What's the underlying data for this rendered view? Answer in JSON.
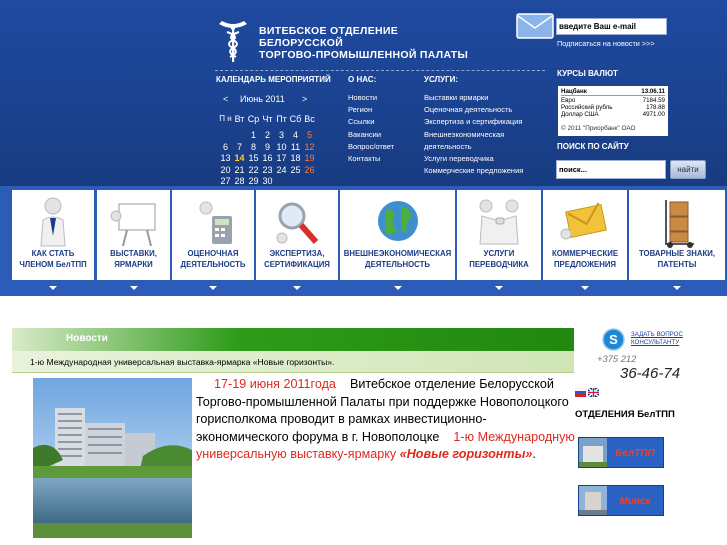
{
  "org": {
    "line1": "ВИТЕБСКОЕ ОТДЕЛЕНИЕ",
    "line2": "БЕЛОРУССКОЙ",
    "line3": "ТОРГОВО-ПРОМЫШЛЕННОЙ ПАЛАТЫ"
  },
  "sections": {
    "calendar": "КАЛЕНДАРЬ МЕРОПРИЯТИЙ",
    "about": "О НАС:",
    "services": "УСЛУГИ:"
  },
  "calendar": {
    "prev": "<",
    "month": "Июнь 2011",
    "next": ">",
    "days": [
      "П н",
      "Вт",
      "Ср",
      "Чт",
      "Пт",
      "Сб",
      "Вс"
    ],
    "weeks": [
      [
        "",
        "",
        "1",
        "2",
        "3",
        "4",
        "5"
      ],
      [
        "6",
        "7",
        "8",
        "9",
        "10",
        "11",
        "12"
      ],
      [
        "13",
        "14",
        "15",
        "16",
        "17",
        "18",
        "19"
      ],
      [
        "20",
        "21",
        "22",
        "23",
        "24",
        "25",
        "26"
      ],
      [
        "27",
        "28",
        "29",
        "30",
        "",
        "",
        ""
      ]
    ],
    "today": "14"
  },
  "about_links": [
    "Новости",
    "Регион",
    "Ссылки",
    "Вакансии",
    "Вопрос/ответ",
    "Контакты"
  ],
  "service_links": [
    "Выставки ярмарки",
    "Оценочная деятельность",
    "Экспертиза и сертификация",
    "Внешнеэкономическая",
    "деятельность",
    "Услуги переводчика",
    "Коммерческие предложения"
  ],
  "email": {
    "placeholder": "введите Ваш e-mail",
    "subscribe": "Подписаться на новости >>>"
  },
  "currency": {
    "title": "КУРСЫ ВАЛЮТ",
    "header": [
      "Нацбанк",
      "13.06.11"
    ],
    "rows": [
      [
        "Евро",
        "7184.59"
      ],
      [
        "Российский рубль",
        "178.88"
      ],
      [
        "Доллар США",
        "4971.00"
      ]
    ],
    "copyright": "© 2011 \"Приорбанк\" ОАО"
  },
  "search": {
    "title": "ПОИСК ПО САЙТУ",
    "placeholder": "поиск...",
    "button": "найти"
  },
  "nav": [
    {
      "line1": "КАК СТАТЬ",
      "line2": "ЧЛЕНОМ БелТПП"
    },
    {
      "line1": "ВЫСТАВКИ,",
      "line2": "ЯРМАРКИ"
    },
    {
      "line1": "ОЦЕНОЧНАЯ",
      "line2": "ДЕЯТЕЛЬНОСТЬ"
    },
    {
      "line1": "ЭКСПЕРТИЗА,",
      "line2": "СЕРТИФИКАЦИЯ"
    },
    {
      "line1": "ВНЕШНЕЭКОНОМИЧЕСКАЯ",
      "line2": "ДЕЯТЕЛЬНОСТЬ"
    },
    {
      "line1": "УСЛУГИ",
      "line2": "ПЕРЕВОДЧИКА"
    },
    {
      "line1": "КОММЕРЧЕСКИЕ",
      "line2": "ПРЕДЛОЖЕНИЯ"
    },
    {
      "line1": "ТОВАРНЫЕ ЗНАКИ,",
      "line2": "ПАТЕНТЫ"
    }
  ],
  "news": {
    "title": "Новости",
    "headline": "1-ю Международная универсальная выставка-ярмарка «Новые горизонты».",
    "date": "17-19 июня 2011года",
    "body1": "Витебское отделение Белорусской Торгово-промышленной Палаты при поддержке Новополоцкого горисполкома проводит в рамках инвестиционно-экономического форума в г. Новополоцке",
    "body2": "1-ю Международную универсальную выставку-ярмарку",
    "body3": "«Новые горизонты»",
    "body4": "."
  },
  "side": {
    "ask": "ЗАДАТЬ ВОПРОС КОНСУЛЬТАНТУ",
    "ask_line1": "ЗАДАТЬ ВОПРОС",
    "ask_line2": "КОНСУЛЬТАНТУ",
    "phone_prefix": "+375 212",
    "phone": "36-46-74",
    "departments_title": "ОТДЕЛЕНИЯ БелТПП",
    "departments": [
      "БелТПП",
      "Минск"
    ]
  },
  "colors": {
    "header": "#1f4aa0",
    "band": "#2c5bb8",
    "accent_red": "#e0291e",
    "news_green": "#2e9b1a"
  }
}
